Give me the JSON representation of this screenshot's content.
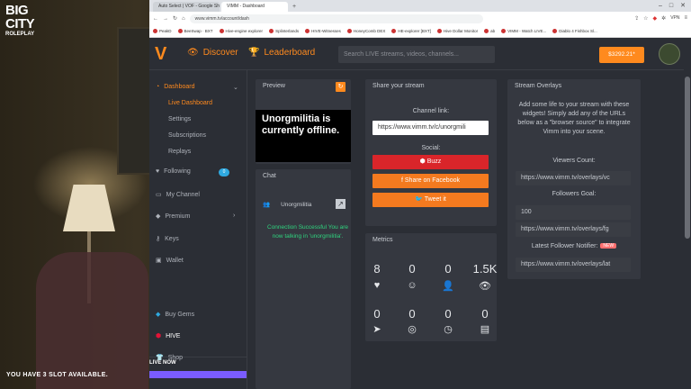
{
  "game": {
    "logo_line1": "BIG",
    "logo_line2": "CITY",
    "logo_line3": "ROLEPLAY",
    "slot_text": "YOU HAVE 3 SLOT AVAILABLE."
  },
  "browser": {
    "tabs": [
      "Auto Select | VOF - Google Sheets",
      "VIMM - Dashboard"
    ],
    "url": "www.vimm.tv/account/dash",
    "vpn_label": "VPN",
    "bookmarks": [
      "PeakD",
      "BeeSwap · BXT",
      "Hive-engine explorer",
      "Splinterlands",
      "HIVE-Witnesses",
      "HoneyComb DEX",
      "HE-explorer [BXT]",
      "Hive Dollar Monitor",
      "ab",
      "VIMM - Watch LIVE...",
      "Diablo 4 Fishbox Sl..."
    ]
  },
  "header": {
    "discover": "Discover",
    "leaderboard": "Leaderboard",
    "search_placeholder": "Search LIVE streams, videos, channels...",
    "balance": "$3292.21*"
  },
  "sidebar": {
    "dashboard": "Dashboard",
    "sub_items": [
      "Live Dashboard",
      "Settings",
      "Subscriptions",
      "Replays"
    ],
    "following": "Following",
    "following_count": "0",
    "my_channel": "My Channel",
    "premium": "Premium",
    "keys": "Keys",
    "wallet": "Wallet",
    "live_now": "LIVE NOW",
    "buy_gems": "Buy Gems",
    "hive": "HIVE",
    "shop": "Shop"
  },
  "preview": {
    "title": "Preview",
    "offline_text": "Unorgmilitia is currently offline."
  },
  "chat": {
    "title": "Chat",
    "user": "Unorgmilitia",
    "message": "Connection Successful You are now talking in 'unorgmilitia'."
  },
  "share": {
    "title": "Share your stream",
    "channel_label": "Channel link:",
    "channel_url": "https://www.vimm.tv/c/unorgmili",
    "social_label": "Social:",
    "buzz": "Buzz",
    "facebook": "Share on Facebook",
    "tweet": "Tweet it"
  },
  "metrics": {
    "title": "Metrics",
    "row1": [
      "8",
      "0",
      "0",
      "1.5K"
    ],
    "row2": [
      "0",
      "0",
      "0",
      "0"
    ]
  },
  "overlays": {
    "title": "Stream Overlays",
    "description": "Add some life to your stream with these widgets! Simply add any of the URLs below as a \"browser source\" to integrate Vimm into your scene.",
    "viewers_label": "Viewers Count:",
    "viewers_url": "https://www.vimm.tv/overlays/vc",
    "followers_label": "Followers Goal:",
    "followers_goal": "100",
    "followers_url": "https://www.vimm.tv/overlays/fg",
    "latest_label": "Latest Follower Notifier:",
    "new_badge": "NEW",
    "latest_url": "https://www.vimm.tv/overlays/lat"
  },
  "colors": {
    "accent": "#ff8a1e",
    "panel": "#353840",
    "background": "#2b2e35",
    "success": "#2fd47e",
    "buzz_red": "#d9252a"
  }
}
